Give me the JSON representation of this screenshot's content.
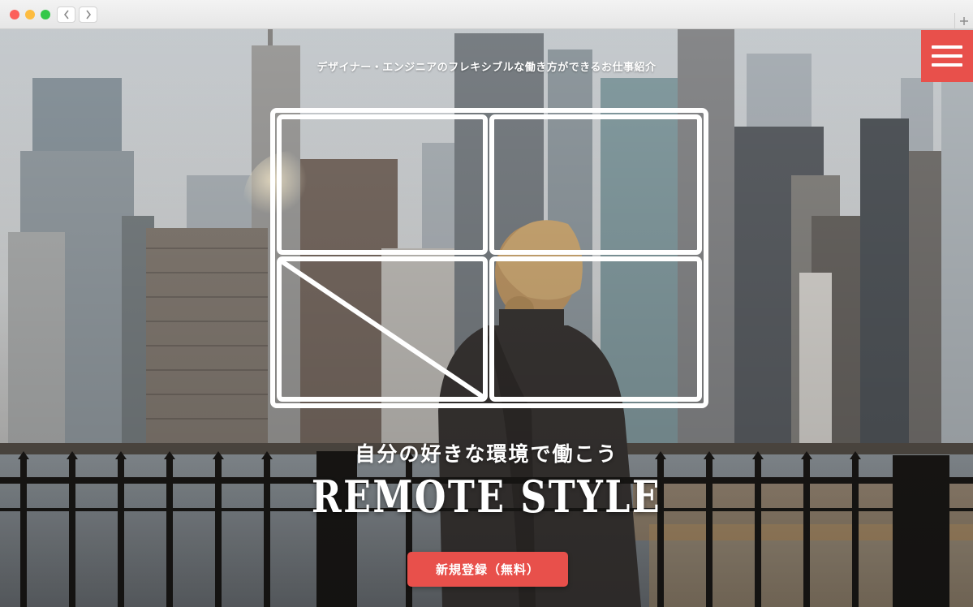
{
  "site": {
    "tagline": "デザイナー・エンジニアのフレキシブルな働き方ができるお仕事紹介",
    "subtitle": "自分の好きな環境で働こう",
    "brand": "REMOTE STYLE",
    "cta_label": "新規登録（無料）"
  },
  "icons": {
    "menu": "hamburger-menu-icon",
    "back": "chevron-left-icon",
    "forward": "chevron-right-icon",
    "new_tab": "plus-icon"
  },
  "colors": {
    "accent": "#e8504b",
    "text_on_image": "#ffffff"
  }
}
